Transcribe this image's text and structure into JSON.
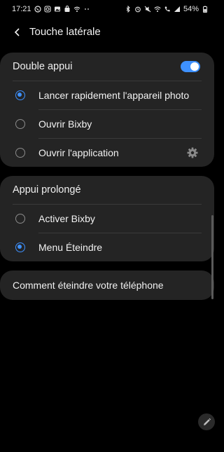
{
  "status_bar": {
    "time": "17:21",
    "battery": "54%",
    "left_icons": [
      "whatsapp-icon",
      "instagram-icon",
      "gallery-icon",
      "store-icon",
      "wifi-share-icon",
      "more-dots-icon"
    ],
    "right_icons": [
      "bluetooth-icon",
      "alarm-icon",
      "mute-icon",
      "wifi-icon",
      "call-icon",
      "signal-icon"
    ]
  },
  "header": {
    "back_icon": "back-chevron-icon",
    "title": "Touche latérale"
  },
  "double_press": {
    "label": "Double appui",
    "toggle_on": true,
    "options": [
      {
        "label": "Lancer rapidement l'appareil photo",
        "selected": true
      },
      {
        "label": "Ouvrir Bixby",
        "selected": false
      },
      {
        "label": "Ouvrir l'application",
        "selected": false,
        "icon": "gear-icon"
      }
    ]
  },
  "long_press": {
    "label": "Appui prolongé",
    "options": [
      {
        "label": "Activer Bixby",
        "selected": false
      },
      {
        "label": "Menu Éteindre",
        "selected": true
      }
    ]
  },
  "help_link": {
    "label": "Comment éteindre votre téléphone"
  },
  "colors": {
    "accent": "#3e91ff",
    "card_bg": "#242424",
    "background": "#000000"
  }
}
